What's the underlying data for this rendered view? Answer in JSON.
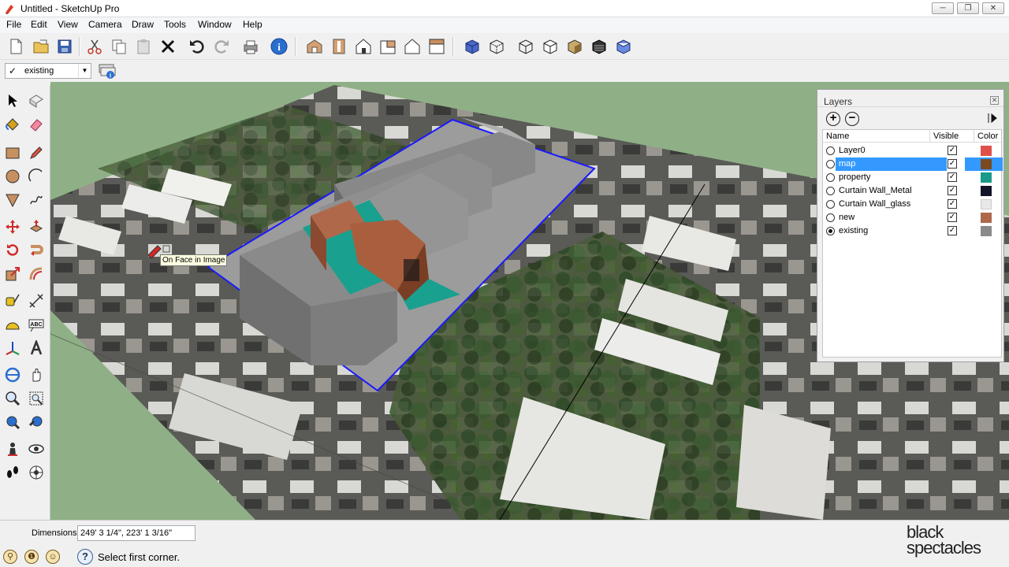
{
  "window": {
    "title": "Untitled - SketchUp Pro",
    "minimize": "─",
    "restore": "❐",
    "close": "✕"
  },
  "menu": [
    "File",
    "Edit",
    "View",
    "Camera",
    "Draw",
    "Tools",
    "Window",
    "Help"
  ],
  "layer_toolbar": {
    "current_layer": "existing"
  },
  "viewport": {
    "tooltip": "On Face in Image"
  },
  "layers_panel": {
    "title": "Layers",
    "columns": {
      "name": "Name",
      "visible": "Visible",
      "color": "Color"
    },
    "layers": [
      {
        "name": "Layer0",
        "visible": true,
        "color": "#e0504a",
        "active": false,
        "selected": false
      },
      {
        "name": "map",
        "visible": true,
        "color": "#7a4a1e",
        "active": false,
        "selected": true
      },
      {
        "name": "property",
        "visible": true,
        "color": "#1a9a88",
        "active": false,
        "selected": false
      },
      {
        "name": "Curtain Wall_Metal",
        "visible": true,
        "color": "#121428",
        "active": false,
        "selected": false
      },
      {
        "name": "Curtain Wall_glass",
        "visible": true,
        "color": "#e8e8e8",
        "active": false,
        "selected": false
      },
      {
        "name": "new",
        "visible": true,
        "color": "#b0684a",
        "active": false,
        "selected": false
      },
      {
        "name": "existing",
        "visible": true,
        "color": "#8a8a8a",
        "active": true,
        "selected": false
      }
    ]
  },
  "dimensions": {
    "label": "Dimensions",
    "value": "249' 3 1/4\", 223' 1 3/16\""
  },
  "status": {
    "message": "Select first corner."
  },
  "branding": {
    "line1": "black",
    "line2": "spectacles"
  }
}
